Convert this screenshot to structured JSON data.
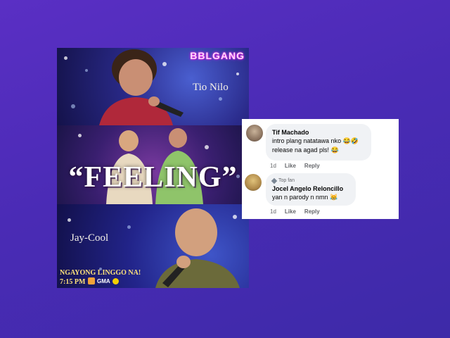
{
  "poster": {
    "logo": "BBLGANG",
    "singer_top": "Tio Nilo",
    "title": "“FEELING”",
    "singer_bottom": "Jay-Cool",
    "airing_line1": "NGAYONG LINGGO NA!",
    "airing_line2": "7:15 PM",
    "network": "GMA",
    "colors": {
      "accent_text": "#ffe27a",
      "logo_glow": "#ff3fd0"
    }
  },
  "comments": [
    {
      "author": "Tif Machado",
      "badge": "",
      "lines": [
        "intro plang natatawa nko 😂🤣",
        "release na agad pls! 😂"
      ],
      "time": "1d",
      "like_label": "Like",
      "reply_label": "Reply"
    },
    {
      "author": "Jocel Angelo Reloncillo",
      "badge": "Top fan",
      "lines": [
        "yan n parody n nmn 😹"
      ],
      "time": "1d",
      "like_label": "Like",
      "reply_label": "Reply"
    }
  ]
}
